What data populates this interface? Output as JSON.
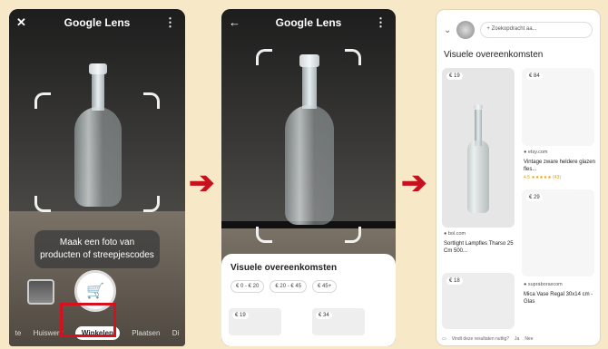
{
  "phone1": {
    "app_title": "Google Lens",
    "back_icon": "x-icon",
    "more_icon": "more-vert-icon",
    "hint_line1": "Maak een foto van",
    "hint_line2": "producten of streepjescodes",
    "shutter_icon": "shopping-cart-icon",
    "modes": [
      "te",
      "Huiswerk",
      "Winkelen",
      "Plaatsen",
      "Di"
    ],
    "active_mode": "Winkelen"
  },
  "phone2": {
    "app_title": "Google Lens",
    "back_icon": "arrow-left-icon",
    "sheet_title": "Visuele overeenkomsten",
    "price_filters": [
      "€ 0 - € 20",
      "€ 20 - € 45",
      "€ 45+"
    ],
    "prices": [
      "€ 19",
      "€ 34"
    ]
  },
  "phone3": {
    "search_chip": "Zoekopdracht aa...",
    "section_title": "Visuele overeenkomsten",
    "results": [
      {
        "price": "€ 19",
        "source": "bol.com",
        "title": "Sortlight Lampfles Tharso 25 Cm 500..."
      },
      {
        "price": "€ 84",
        "source": "etsy.com",
        "title": "Vintage zware heldere glazen fles...",
        "rating": "4.5 ★★★★★ (43)"
      },
      {
        "price": "€ 29",
        "source": "",
        "title": ""
      },
      {
        "price": "€ 18",
        "source": "",
        "title": ""
      },
      {
        "price": "",
        "source": "supraboraxcom",
        "title": "Mica Vase Regal 30x14 cm - Glas"
      }
    ],
    "feedback_text": "Vindt deze resultaten nuttig?",
    "feedback_yes": "Ja",
    "feedback_no": "Nee"
  },
  "colors": {
    "accent_red": "#d8101e",
    "background": "#f7e8c8"
  }
}
